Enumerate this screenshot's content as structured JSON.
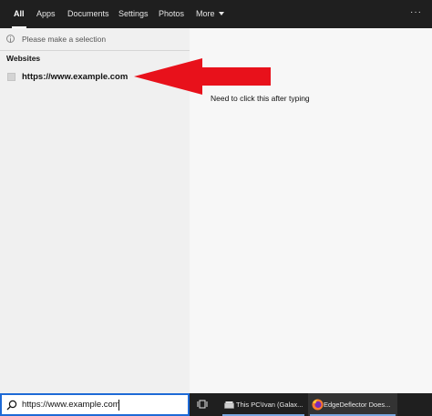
{
  "tabs": [
    {
      "label": "All",
      "active": true
    },
    {
      "label": "Apps",
      "active": false
    },
    {
      "label": "Documents",
      "active": false
    },
    {
      "label": "Settings",
      "active": false
    },
    {
      "label": "Photos",
      "active": false
    },
    {
      "label": "More",
      "active": false
    }
  ],
  "more_icon": "chevron-down-icon",
  "overflow_label": "···",
  "selection_hint": "Please make a selection",
  "section_header": "Websites",
  "result": {
    "label": "https://www.example.com",
    "icon": "globe-icon"
  },
  "annotation": "Need to click this after typing",
  "arrow_color": "#e8111b",
  "search": {
    "value": "https://www.example.com",
    "icon": "search-icon"
  },
  "taskbar": {
    "apps": [
      {
        "label": "This PC\\Ivan (Galax...",
        "icon": "file-explorer-icon"
      },
      {
        "label": "EdgeDeflector Does...",
        "icon": "firefox-icon"
      }
    ]
  },
  "colors": {
    "accent": "#1e6ad6",
    "taskbar": "#1f1f1f",
    "arrow": "#e8111b"
  }
}
